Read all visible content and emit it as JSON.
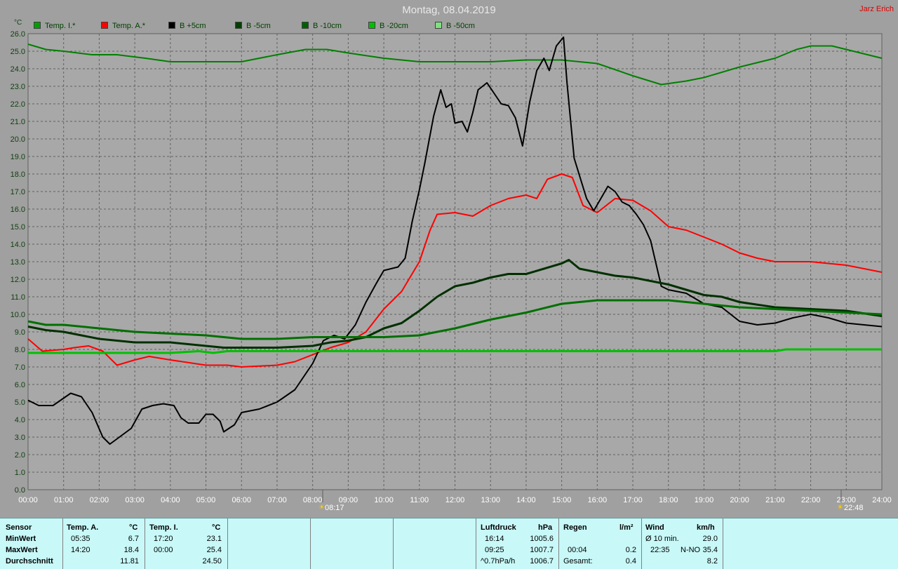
{
  "header": {
    "title": "Montag, 08.04.2019",
    "corner": "Jarz Erich",
    "unit": "°C"
  },
  "legend": [
    {
      "label": "Temp. I.*",
      "color": "#00a000"
    },
    {
      "label": "Temp. A.*",
      "color": "#ff0000"
    },
    {
      "label": "B +5cm",
      "color": "#000000"
    },
    {
      "label": "B -5cm",
      "color": "#004000"
    },
    {
      "label": "B -10cm",
      "color": "#006000"
    },
    {
      "label": "B -20cm",
      "color": "#00c000"
    },
    {
      "label": "B -50cm",
      "color": "#80e080"
    }
  ],
  "markers": {
    "sunrise": "08:17",
    "sunset": "22:48"
  },
  "chart_data": {
    "type": "line",
    "ylim": [
      0,
      26
    ],
    "xlim": [
      "00:00",
      "24:00"
    ],
    "grid": true,
    "legend_position": "top",
    "y_ticks": [
      "0.0",
      "1.0",
      "2.0",
      "3.0",
      "4.0",
      "5.0",
      "6.0",
      "7.0",
      "8.0",
      "9.0",
      "10.0",
      "11.0",
      "12.0",
      "13.0",
      "14.0",
      "15.0",
      "16.0",
      "17.0",
      "18.0",
      "19.0",
      "20.0",
      "21.0",
      "22.0",
      "23.0",
      "24.0",
      "25.0",
      "26.0"
    ],
    "x_ticks": [
      "00:00",
      "01:00",
      "02:00",
      "03:00",
      "04:00",
      "05:00",
      "06:00",
      "07:00",
      "08:00",
      "09:00",
      "10:00",
      "11:00",
      "12:00",
      "13:00",
      "14:00",
      "15:00",
      "16:00",
      "17:00",
      "18:00",
      "19:00",
      "20:00",
      "21:00",
      "22:00",
      "23:00",
      "24:00"
    ],
    "series": [
      {
        "name": "Temp. I.*",
        "color": "#008000",
        "width": 2,
        "points": [
          [
            0,
            25.4
          ],
          [
            0.5,
            25.1
          ],
          [
            1,
            25.0
          ],
          [
            1.8,
            24.8
          ],
          [
            2.5,
            24.8
          ],
          [
            3.3,
            24.6
          ],
          [
            4,
            24.4
          ],
          [
            5,
            24.4
          ],
          [
            6,
            24.4
          ],
          [
            7,
            24.8
          ],
          [
            7.8,
            25.1
          ],
          [
            8.4,
            25.1
          ],
          [
            9,
            24.9
          ],
          [
            10,
            24.6
          ],
          [
            11,
            24.4
          ],
          [
            12,
            24.4
          ],
          [
            13,
            24.4
          ],
          [
            14,
            24.5
          ],
          [
            15,
            24.5
          ],
          [
            16,
            24.3
          ],
          [
            17,
            23.6
          ],
          [
            17.8,
            23.1
          ],
          [
            18.5,
            23.3
          ],
          [
            19,
            23.5
          ],
          [
            20,
            24.1
          ],
          [
            21,
            24.6
          ],
          [
            21.6,
            25.1
          ],
          [
            22,
            25.3
          ],
          [
            22.6,
            25.3
          ],
          [
            23.2,
            25.0
          ],
          [
            24,
            24.6
          ]
        ]
      },
      {
        "name": "Temp. A.*",
        "color": "#ff0000",
        "width": 2,
        "points": [
          [
            0,
            8.6
          ],
          [
            0.4,
            7.9
          ],
          [
            1,
            8.0
          ],
          [
            1.3,
            8.1
          ],
          [
            1.7,
            8.2
          ],
          [
            2.1,
            7.9
          ],
          [
            2.5,
            7.1
          ],
          [
            3,
            7.4
          ],
          [
            3.4,
            7.6
          ],
          [
            4,
            7.4
          ],
          [
            5,
            7.1
          ],
          [
            5.6,
            7.1
          ],
          [
            6,
            7.0
          ],
          [
            7,
            7.1
          ],
          [
            7.5,
            7.3
          ],
          [
            8,
            7.7
          ],
          [
            8.5,
            8.1
          ],
          [
            9,
            8.4
          ],
          [
            9.5,
            9.0
          ],
          [
            10,
            10.3
          ],
          [
            10.5,
            11.3
          ],
          [
            11,
            13.0
          ],
          [
            11.3,
            14.8
          ],
          [
            11.5,
            15.7
          ],
          [
            12,
            15.8
          ],
          [
            12.5,
            15.6
          ],
          [
            13,
            16.2
          ],
          [
            13.5,
            16.6
          ],
          [
            14,
            16.8
          ],
          [
            14.3,
            16.6
          ],
          [
            14.6,
            17.7
          ],
          [
            15,
            18.0
          ],
          [
            15.3,
            17.8
          ],
          [
            15.6,
            16.2
          ],
          [
            16,
            15.8
          ],
          [
            16.5,
            16.6
          ],
          [
            17,
            16.5
          ],
          [
            17.5,
            15.9
          ],
          [
            18,
            15.0
          ],
          [
            18.5,
            14.8
          ],
          [
            19,
            14.4
          ],
          [
            19.5,
            14.0
          ],
          [
            20,
            13.5
          ],
          [
            20.5,
            13.2
          ],
          [
            21,
            13.0
          ],
          [
            22,
            13.0
          ],
          [
            22.5,
            12.9
          ],
          [
            23,
            12.8
          ],
          [
            24,
            12.4
          ]
        ]
      },
      {
        "name": "B +5cm",
        "color": "#000000",
        "width": 2,
        "points": [
          [
            0,
            5.1
          ],
          [
            0.3,
            4.8
          ],
          [
            0.7,
            4.8
          ],
          [
            1.2,
            5.5
          ],
          [
            1.5,
            5.3
          ],
          [
            1.8,
            4.4
          ],
          [
            2.1,
            3.0
          ],
          [
            2.3,
            2.6
          ],
          [
            2.5,
            2.9
          ],
          [
            2.9,
            3.5
          ],
          [
            3.2,
            4.6
          ],
          [
            3.5,
            4.8
          ],
          [
            3.8,
            4.9
          ],
          [
            4.1,
            4.8
          ],
          [
            4.3,
            4.1
          ],
          [
            4.5,
            3.8
          ],
          [
            4.8,
            3.8
          ],
          [
            5.0,
            4.3
          ],
          [
            5.2,
            4.3
          ],
          [
            5.4,
            3.9
          ],
          [
            5.5,
            3.3
          ],
          [
            5.8,
            3.7
          ],
          [
            6.0,
            4.4
          ],
          [
            6.5,
            4.6
          ],
          [
            7,
            5.0
          ],
          [
            7.5,
            5.7
          ],
          [
            8,
            7.2
          ],
          [
            8.3,
            8.5
          ],
          [
            8.6,
            8.8
          ],
          [
            8.9,
            8.6
          ],
          [
            9.2,
            9.4
          ],
          [
            9.5,
            10.7
          ],
          [
            9.8,
            11.8
          ],
          [
            10,
            12.5
          ],
          [
            10.4,
            12.7
          ],
          [
            10.6,
            13.2
          ],
          [
            10.8,
            15.3
          ],
          [
            11,
            17.1
          ],
          [
            11.15,
            18.6
          ],
          [
            11.4,
            21.3
          ],
          [
            11.6,
            22.8
          ],
          [
            11.75,
            21.8
          ],
          [
            11.9,
            22.0
          ],
          [
            12,
            20.9
          ],
          [
            12.2,
            21.0
          ],
          [
            12.35,
            20.4
          ],
          [
            12.5,
            21.5
          ],
          [
            12.65,
            22.8
          ],
          [
            12.9,
            23.2
          ],
          [
            13.1,
            22.6
          ],
          [
            13.3,
            22.0
          ],
          [
            13.5,
            21.9
          ],
          [
            13.7,
            21.2
          ],
          [
            13.9,
            19.6
          ],
          [
            14.1,
            22.1
          ],
          [
            14.3,
            23.9
          ],
          [
            14.5,
            24.6
          ],
          [
            14.65,
            23.9
          ],
          [
            14.85,
            25.3
          ],
          [
            15.05,
            25.8
          ],
          [
            15.15,
            23.2
          ],
          [
            15.35,
            18.9
          ],
          [
            15.7,
            16.6
          ],
          [
            15.9,
            15.9
          ],
          [
            16.1,
            16.6
          ],
          [
            16.3,
            17.3
          ],
          [
            16.5,
            17.0
          ],
          [
            16.7,
            16.4
          ],
          [
            16.9,
            16.2
          ],
          [
            17.1,
            15.7
          ],
          [
            17.3,
            15.1
          ],
          [
            17.5,
            14.2
          ],
          [
            17.8,
            11.6
          ],
          [
            18,
            11.4
          ],
          [
            18.5,
            11.2
          ],
          [
            19,
            10.6
          ],
          [
            19.5,
            10.4
          ],
          [
            20,
            9.6
          ],
          [
            20.5,
            9.4
          ],
          [
            21,
            9.5
          ],
          [
            21.5,
            9.8
          ],
          [
            22,
            10.0
          ],
          [
            22.5,
            9.8
          ],
          [
            23,
            9.5
          ],
          [
            23.5,
            9.4
          ],
          [
            24,
            9.3
          ]
        ]
      },
      {
        "name": "B -5cm",
        "color": "#003000",
        "width": 3,
        "points": [
          [
            0,
            9.3
          ],
          [
            0.5,
            9.1
          ],
          [
            1,
            9.0
          ],
          [
            1.5,
            8.8
          ],
          [
            2,
            8.6
          ],
          [
            2.5,
            8.5
          ],
          [
            3,
            8.4
          ],
          [
            4,
            8.4
          ],
          [
            5,
            8.2
          ],
          [
            5.5,
            8.1
          ],
          [
            6,
            8.1
          ],
          [
            7,
            8.1
          ],
          [
            8,
            8.2
          ],
          [
            8.5,
            8.4
          ],
          [
            9,
            8.5
          ],
          [
            9.5,
            8.7
          ],
          [
            10,
            9.2
          ],
          [
            10.5,
            9.5
          ],
          [
            11,
            10.2
          ],
          [
            11.5,
            11.0
          ],
          [
            12,
            11.6
          ],
          [
            12.5,
            11.8
          ],
          [
            13,
            12.1
          ],
          [
            13.5,
            12.3
          ],
          [
            14,
            12.3
          ],
          [
            14.5,
            12.6
          ],
          [
            15,
            12.9
          ],
          [
            15.2,
            13.1
          ],
          [
            15.5,
            12.6
          ],
          [
            16,
            12.4
          ],
          [
            16.5,
            12.2
          ],
          [
            17,
            12.1
          ],
          [
            17.5,
            11.9
          ],
          [
            18,
            11.7
          ],
          [
            18.5,
            11.4
          ],
          [
            19,
            11.1
          ],
          [
            19.5,
            11.0
          ],
          [
            20,
            10.7
          ],
          [
            21,
            10.4
          ],
          [
            22,
            10.3
          ],
          [
            23,
            10.2
          ],
          [
            24,
            9.9
          ]
        ]
      },
      {
        "name": "B -10cm",
        "color": "#007000",
        "width": 3,
        "points": [
          [
            0,
            9.6
          ],
          [
            0.5,
            9.4
          ],
          [
            1,
            9.4
          ],
          [
            2,
            9.2
          ],
          [
            3,
            9.0
          ],
          [
            4,
            8.9
          ],
          [
            5,
            8.8
          ],
          [
            6,
            8.6
          ],
          [
            7,
            8.6
          ],
          [
            8,
            8.7
          ],
          [
            9,
            8.7
          ],
          [
            10,
            8.7
          ],
          [
            11,
            8.8
          ],
          [
            12,
            9.2
          ],
          [
            13,
            9.7
          ],
          [
            14,
            10.1
          ],
          [
            15,
            10.6
          ],
          [
            16,
            10.8
          ],
          [
            17,
            10.8
          ],
          [
            18,
            10.8
          ],
          [
            19,
            10.6
          ],
          [
            20,
            10.4
          ],
          [
            21,
            10.3
          ],
          [
            22,
            10.2
          ],
          [
            23,
            10.1
          ],
          [
            24,
            10.0
          ]
        ]
      },
      {
        "name": "B -20cm",
        "color": "#00c000",
        "width": 3,
        "points": [
          [
            0,
            7.8
          ],
          [
            1,
            7.8
          ],
          [
            2,
            7.8
          ],
          [
            3,
            7.8
          ],
          [
            4,
            7.8
          ],
          [
            4.8,
            7.9
          ],
          [
            5.2,
            7.8
          ],
          [
            5.6,
            7.9
          ],
          [
            6,
            7.9
          ],
          [
            8,
            7.9
          ],
          [
            10,
            7.9
          ],
          [
            14,
            7.9
          ],
          [
            18,
            7.9
          ],
          [
            21,
            7.9
          ],
          [
            21.3,
            8.0
          ],
          [
            24,
            8.0
          ]
        ]
      }
    ]
  },
  "stats": {
    "sensor_label": "Sensor",
    "row_labels": [
      "MinWert",
      "MaxWert",
      "Durchschnitt"
    ],
    "temp_a": {
      "title": "Temp. A.",
      "unit": "°C",
      "min_time": "05:35",
      "min_val": "6.7",
      "max_time": "14:20",
      "max_val": "18.4",
      "avg": "11.81"
    },
    "temp_i": {
      "title": "Temp. I.",
      "unit": "°C",
      "min_time": "17:20",
      "min_val": "23.1",
      "max_time": "00:00",
      "max_val": "25.4",
      "avg": "24.50"
    },
    "pressure": {
      "title": "Luftdruck",
      "unit": "hPa",
      "min_time": "16:14",
      "min_val": "1005.6",
      "max_time": "09:25",
      "max_val": "1007.7",
      "trend_label": "^0.7hPa/h",
      "current": "1006.7"
    },
    "rain": {
      "title": "Regen",
      "unit": "l/m²",
      "max_time": "00:04",
      "max_val": "0.2",
      "total_label": "Gesamt:",
      "total": "0.4"
    },
    "wind": {
      "title": "Wind",
      "unit": "km/h",
      "avg_label": "Ø 10 min.",
      "avg_val": "29.0",
      "max_time": "22:35",
      "max_dir": "N-NO",
      "max_val": "35.4",
      "current": "8.2"
    }
  }
}
